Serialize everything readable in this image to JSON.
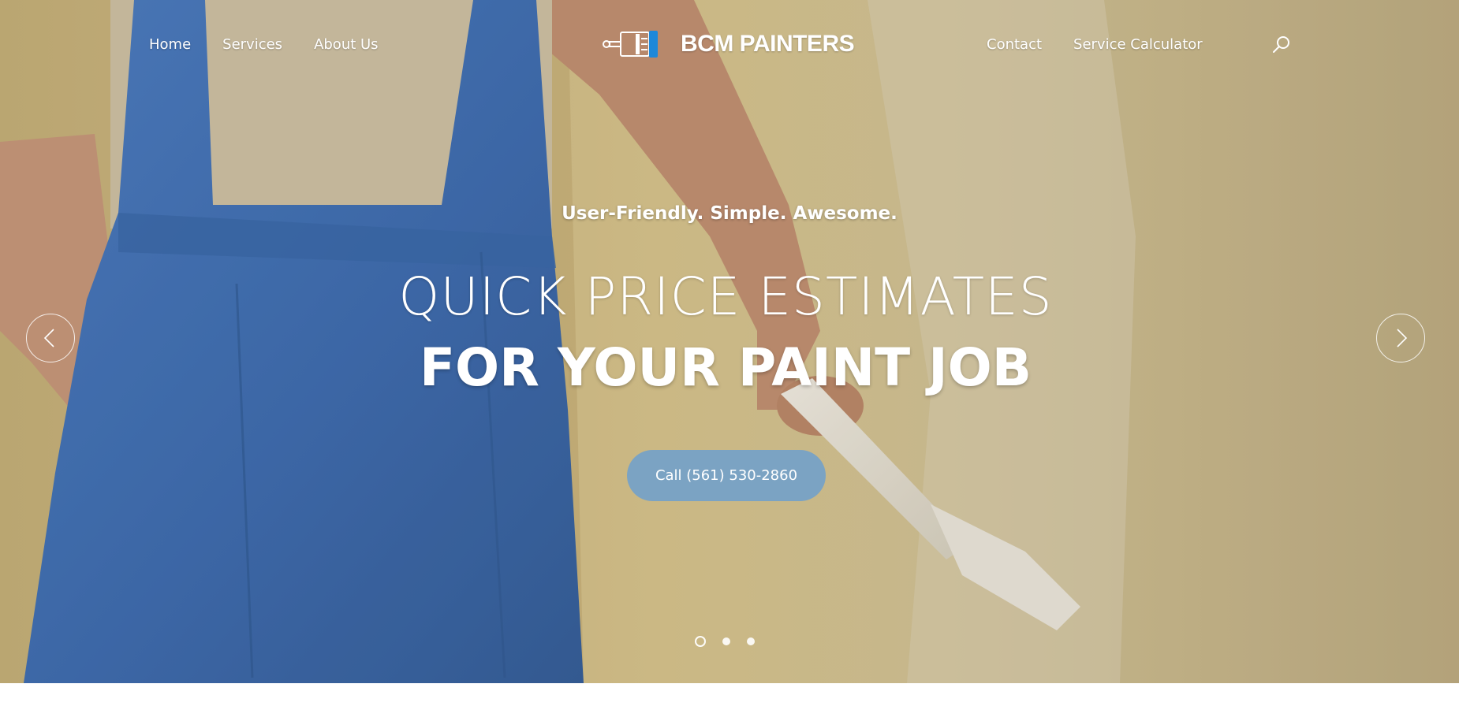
{
  "header": {
    "nav_left": [
      "Home",
      "Services",
      "About Us"
    ],
    "logo_text": "BCM PAINTERS",
    "nav_right": [
      "Contact",
      "Service Calculator"
    ],
    "search_icon": "search-icon"
  },
  "hero": {
    "tagline": "User-Friendly. Simple. Awesome.",
    "headline_line1": "QUICK PRICE ESTIMATES",
    "headline_line2": "FOR YOUR PAINT JOB",
    "cta_label": "Call (561) 530-2860",
    "prev_icon": "chevron-left-icon",
    "next_icon": "chevron-right-icon",
    "slides_total": 3,
    "active_slide": 1
  },
  "colors": {
    "cta_bg": "#7ba3c3",
    "logo_accent": "#1e88d9",
    "text": "#ffffff"
  }
}
